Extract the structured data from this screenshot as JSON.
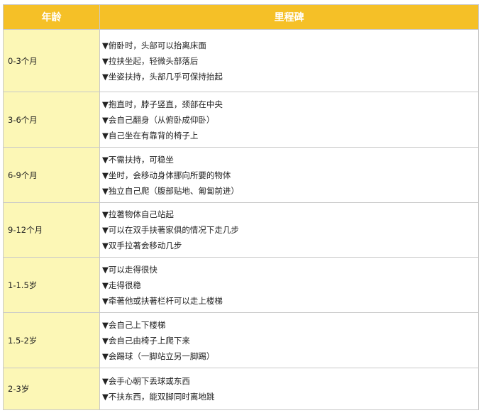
{
  "table": {
    "headers": {
      "age": "年龄",
      "milestone": "里程碑"
    },
    "rows": [
      {
        "age": "0-3个月",
        "milestones": [
          "▼俯卧时，头部可以抬离床面",
          "▼拉扶坐起，轻微头部落后",
          "▼坐姿扶持，头部几乎可保持抬起"
        ]
      },
      {
        "age": "3-6个月",
        "milestones": [
          "▼抱直时，脖子竖直，颈部在中央",
          "▼会自己翻身（从俯卧成仰卧）",
          "▼自己坐在有靠背的椅子上"
        ]
      },
      {
        "age": "6-9个月",
        "milestones": [
          "▼不需扶持，可稳坐",
          "▼坐时，会移动身体挪向所要的物体",
          "▼独立自己爬（腹部贴地、匍匐前进）"
        ]
      },
      {
        "age": "9-12个月",
        "milestones": [
          "▼拉著物体自己站起",
          "▼可以在双手扶著家俱的情况下走几步",
          "▼双手拉著会移动几步"
        ]
      },
      {
        "age": "1-1.5岁",
        "milestones": [
          "▼可以走得很快",
          "▼走得很稳",
          "▼牵著他或扶著栏杆可以走上楼梯"
        ]
      },
      {
        "age": "1.5-2岁",
        "milestones": [
          "▼会自己上下楼梯",
          "▼会自己由椅子上爬下来",
          "▼会踢球（一脚站立另一脚踢）"
        ]
      },
      {
        "age": "2-3岁",
        "milestones": [
          "▼会手心朝下丢球或东西",
          "▼不扶东西，能双脚同时离地跳"
        ]
      }
    ]
  },
  "colors": {
    "header_bg": "#f5c027",
    "age_bg": "#fcf7b6",
    "border": "#c9c9c9"
  }
}
